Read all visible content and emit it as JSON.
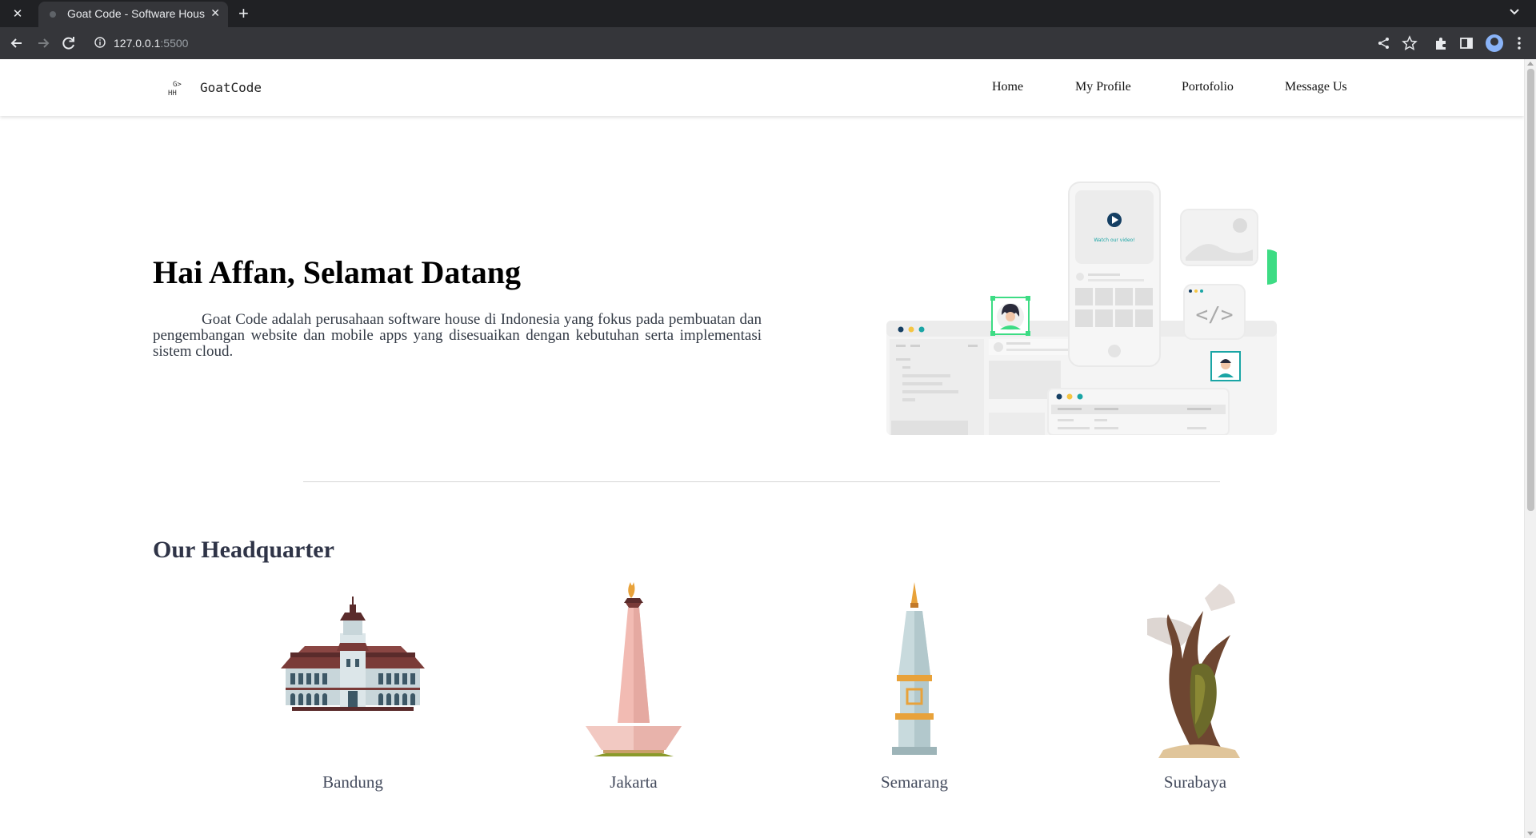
{
  "browser": {
    "tab_title": "Goat Code - Software House",
    "url_host": "127.0.0.1",
    "url_port": ":5500",
    "icons": [
      "close-icon",
      "plus-icon",
      "back-icon",
      "forward-icon",
      "reload-icon",
      "info-icon",
      "share-icon",
      "star-icon",
      "extensions-icon",
      "sidepanel-icon",
      "profile-icon",
      "menu-icon"
    ]
  },
  "navbar": {
    "logo_glyph_top": "G>",
    "logo_glyph_bottom": "HH",
    "brand": "GoatCode",
    "links": [
      "Home",
      "My Profile",
      "Portofolio",
      "Message Us"
    ]
  },
  "hero": {
    "title": "Hai Affan, Selamat Datang",
    "description": "Goat Code adalah perusahaan software house di Indonesia yang fokus pada pembuatan dan pengembangan website dan mobile apps yang disesuaikan dengan kebutuhan serta implementasi sistem cloud.",
    "illustration_caption": "Watch our video!",
    "illustration_code_glyph": "</>"
  },
  "headquarter": {
    "title": "Our Headquarter",
    "cities": [
      "Bandung",
      "Jakarta",
      "Semarang",
      "Surabaya"
    ]
  },
  "colors": {
    "accent_green": "#3ddc84",
    "accent_teal": "#1aa5a5",
    "text_dark": "#2f3447"
  }
}
